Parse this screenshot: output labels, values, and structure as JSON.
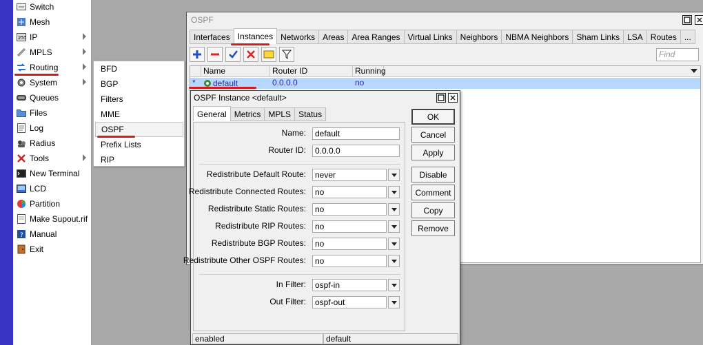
{
  "sidebar": {
    "items": [
      {
        "label": "Switch",
        "icon": "switch-icon",
        "has_submenu": false
      },
      {
        "label": "Mesh",
        "icon": "mesh-icon",
        "has_submenu": false
      },
      {
        "label": "IP",
        "icon": "ip-icon",
        "has_submenu": true
      },
      {
        "label": "MPLS",
        "icon": "mpls-icon",
        "has_submenu": true
      },
      {
        "label": "Routing",
        "icon": "routing-icon",
        "has_submenu": true
      },
      {
        "label": "System",
        "icon": "system-gear-icon",
        "has_submenu": true
      },
      {
        "label": "Queues",
        "icon": "queues-icon",
        "has_submenu": false
      },
      {
        "label": "Files",
        "icon": "files-folder-icon",
        "has_submenu": false
      },
      {
        "label": "Log",
        "icon": "log-icon",
        "has_submenu": false
      },
      {
        "label": "Radius",
        "icon": "radius-icon",
        "has_submenu": false
      },
      {
        "label": "Tools",
        "icon": "tools-icon",
        "has_submenu": true
      },
      {
        "label": "New Terminal",
        "icon": "terminal-icon",
        "has_submenu": false
      },
      {
        "label": "LCD",
        "icon": "lcd-icon",
        "has_submenu": false
      },
      {
        "label": "Partition",
        "icon": "partition-icon",
        "has_submenu": false
      },
      {
        "label": "Make Supout.rif",
        "icon": "supout-icon",
        "has_submenu": false
      },
      {
        "label": "Manual",
        "icon": "manual-icon",
        "has_submenu": false
      },
      {
        "label": "Exit",
        "icon": "exit-icon",
        "has_submenu": false
      }
    ]
  },
  "submenu": {
    "items": [
      {
        "label": "BFD"
      },
      {
        "label": "BGP"
      },
      {
        "label": "Filters"
      },
      {
        "label": "MME"
      },
      {
        "label": "OSPF"
      },
      {
        "label": "Prefix Lists"
      },
      {
        "label": "RIP"
      }
    ]
  },
  "ospf_window": {
    "title": "OSPF",
    "tabs": [
      "Interfaces",
      "Instances",
      "Networks",
      "Areas",
      "Area Ranges",
      "Virtual Links",
      "Neighbors",
      "NBMA Neighbors",
      "Sham Links",
      "LSA",
      "Routes",
      "..."
    ],
    "active_tab": "Instances",
    "find_placeholder": "Find",
    "columns": [
      "Name",
      "Router ID",
      "Running"
    ],
    "rows": [
      {
        "marker": "*",
        "name": "default",
        "router_id": "0.0.0.0",
        "running": "no"
      }
    ]
  },
  "dialog": {
    "title": "OSPF Instance <default>",
    "tabs": [
      "General",
      "Metrics",
      "MPLS",
      "Status"
    ],
    "active_tab": "General",
    "fields": {
      "name": {
        "label": "Name:",
        "value": "default"
      },
      "router_id": {
        "label": "Router ID:",
        "value": "0.0.0.0"
      },
      "redistribute_default": {
        "label": "Redistribute Default Route:",
        "value": "never"
      },
      "redistribute_connected": {
        "label": "Redistribute Connected Routes:",
        "value": "no"
      },
      "redistribute_static": {
        "label": "Redistribute Static Routes:",
        "value": "no"
      },
      "redistribute_rip": {
        "label": "Redistribute RIP Routes:",
        "value": "no"
      },
      "redistribute_bgp": {
        "label": "Redistribute BGP Routes:",
        "value": "no"
      },
      "redistribute_ospf": {
        "label": "Redistribute Other OSPF Routes:",
        "value": "no"
      },
      "in_filter": {
        "label": "In Filter:",
        "value": "ospf-in"
      },
      "out_filter": {
        "label": "Out Filter:",
        "value": "ospf-out"
      }
    },
    "buttons": {
      "ok": "OK",
      "cancel": "Cancel",
      "apply": "Apply",
      "disable": "Disable",
      "comment": "Comment",
      "copy": "Copy",
      "remove": "Remove"
    },
    "status": {
      "left": "enabled",
      "right": "default"
    }
  },
  "colors": {
    "accent_strip": "#3a34c4",
    "highlight_underline": "#d21b1b",
    "selected_row": "#b7d7ff",
    "selected_text": "#2a2a9a"
  }
}
